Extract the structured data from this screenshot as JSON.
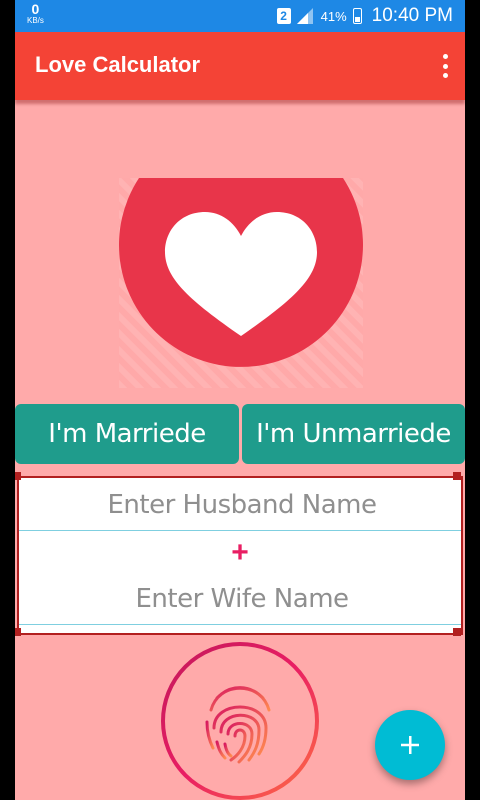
{
  "status_bar": {
    "speed_value": "0",
    "speed_unit": "KB/s",
    "sim_number": "2",
    "battery_percent": "41%",
    "time": "10:40 PM"
  },
  "app_bar": {
    "title": "Love Calculator",
    "menu_icon": "more-vert-icon"
  },
  "buttons": {
    "married": "I'm Marriede",
    "unmarried": "I'm Unmarriede"
  },
  "form": {
    "husband_placeholder": "Enter Husband Name",
    "plus": "+",
    "wife_placeholder": "Enter Wife Name"
  },
  "icons": {
    "heart": "heart-icon",
    "fingerprint": "fingerprint-icon",
    "fab": "plus-icon"
  },
  "colors": {
    "status_bar": "#1e88e5",
    "app_bar": "#f44336",
    "background": "#ffaaaa",
    "button": "#1f9c8c",
    "fab": "#00bcd4",
    "form_border": "#b22020",
    "plus": "#e91e63"
  }
}
